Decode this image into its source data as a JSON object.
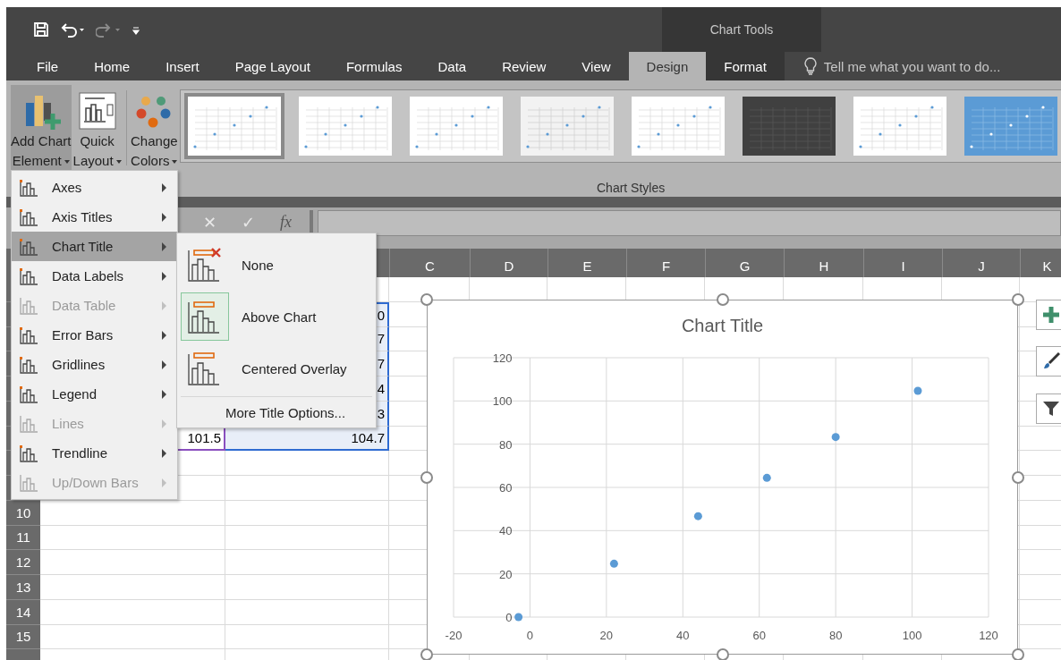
{
  "quick_access": [
    {
      "kind": "save",
      "disabled": false
    },
    {
      "kind": "undo",
      "disabled": false
    },
    {
      "kind": "redo",
      "disabled": true
    },
    {
      "kind": "customize",
      "disabled": false
    }
  ],
  "contextual_group": {
    "title": "Chart Tools"
  },
  "tabs": [
    {
      "label": "File",
      "selected": false,
      "contextual": false
    },
    {
      "label": "Home",
      "selected": false,
      "contextual": false
    },
    {
      "label": "Insert",
      "selected": false,
      "contextual": false
    },
    {
      "label": "Page Layout",
      "selected": false,
      "contextual": false
    },
    {
      "label": "Formulas",
      "selected": false,
      "contextual": false
    },
    {
      "label": "Data",
      "selected": false,
      "contextual": false
    },
    {
      "label": "Review",
      "selected": false,
      "contextual": false
    },
    {
      "label": "View",
      "selected": false,
      "contextual": false
    },
    {
      "label": "Design",
      "selected": true,
      "contextual": true
    },
    {
      "label": "Format",
      "selected": false,
      "contextual": true
    }
  ],
  "tell_me": {
    "placeholder": "Tell me what you want to do..."
  },
  "ribbon": {
    "buttons": [
      {
        "kind": "add-element",
        "lines": [
          "Add Chart",
          "Element"
        ],
        "pressed": true
      },
      {
        "kind": "quick-layout",
        "lines": [
          "Quick",
          "Layout"
        ],
        "pressed": false
      },
      {
        "kind": "colors",
        "lines": [
          "Change",
          "Colors"
        ],
        "pressed": false
      }
    ],
    "chart_styles": [
      {
        "kind": "light",
        "selected": true
      },
      {
        "kind": "light",
        "selected": false
      },
      {
        "kind": "light",
        "selected": false
      },
      {
        "kind": "grey",
        "selected": false
      },
      {
        "kind": "light",
        "selected": false
      },
      {
        "kind": "dark",
        "selected": false
      },
      {
        "kind": "light",
        "selected": false
      },
      {
        "kind": "blue",
        "selected": false
      }
    ],
    "group_label": "Chart Styles"
  },
  "formula_bar": {
    "cancel": "✕",
    "enter": "✓",
    "function": "fx"
  },
  "sheet": {
    "columns": [
      "C",
      "D",
      "E",
      "F",
      "G",
      "H",
      "I",
      "J",
      "K"
    ],
    "row_numbers": [
      "10",
      "11",
      "12",
      "13",
      "14",
      "15"
    ],
    "data_rows": [
      {
        "b": "0"
      },
      {
        "b": "7"
      },
      {
        "b": "7"
      },
      {
        "b": "4"
      },
      {
        "b": "3"
      },
      {
        "a": "101.5",
        "b": "104.7"
      }
    ]
  },
  "chart": {
    "chart_data": {
      "type": "scatter",
      "title": "Chart Title",
      "grid": true,
      "x": [
        -3,
        22,
        44,
        62,
        80,
        101.5
      ],
      "series": [
        {
          "color": "#5b9bd5",
          "values": [
            0,
            24.7,
            46.7,
            64.4,
            83.3,
            104.7
          ]
        }
      ],
      "xlim": [
        -20,
        120
      ],
      "ylim": [
        0,
        120
      ],
      "xticks": [
        -20,
        0,
        20,
        40,
        60,
        80,
        100,
        120
      ],
      "yticks": [
        0,
        20,
        40,
        60,
        80,
        100,
        120
      ]
    }
  },
  "chart_menu": {
    "items": [
      {
        "label": "Axes",
        "disabled": false,
        "selected": false
      },
      {
        "label": "Axis Titles",
        "disabled": false,
        "selected": false
      },
      {
        "label": "Chart Title",
        "disabled": false,
        "selected": true
      },
      {
        "label": "Data Labels",
        "disabled": false,
        "selected": false
      },
      {
        "label": "Data Table",
        "disabled": true,
        "selected": false
      },
      {
        "label": "Error Bars",
        "disabled": false,
        "selected": false
      },
      {
        "label": "Gridlines",
        "disabled": false,
        "selected": false
      },
      {
        "label": "Legend",
        "disabled": false,
        "selected": false
      },
      {
        "label": "Lines",
        "disabled": true,
        "selected": false
      },
      {
        "label": "Trendline",
        "disabled": false,
        "selected": false
      },
      {
        "label": "Up/Down Bars",
        "disabled": true,
        "selected": false
      }
    ]
  },
  "chart_title_menu": {
    "items": [
      {
        "label": "None",
        "kind": "none",
        "selected": false
      },
      {
        "label": "Above Chart",
        "kind": "above",
        "selected": true
      },
      {
        "label": "Centered Overlay",
        "kind": "overlay",
        "selected": false
      }
    ],
    "more": "More Title Options..."
  }
}
